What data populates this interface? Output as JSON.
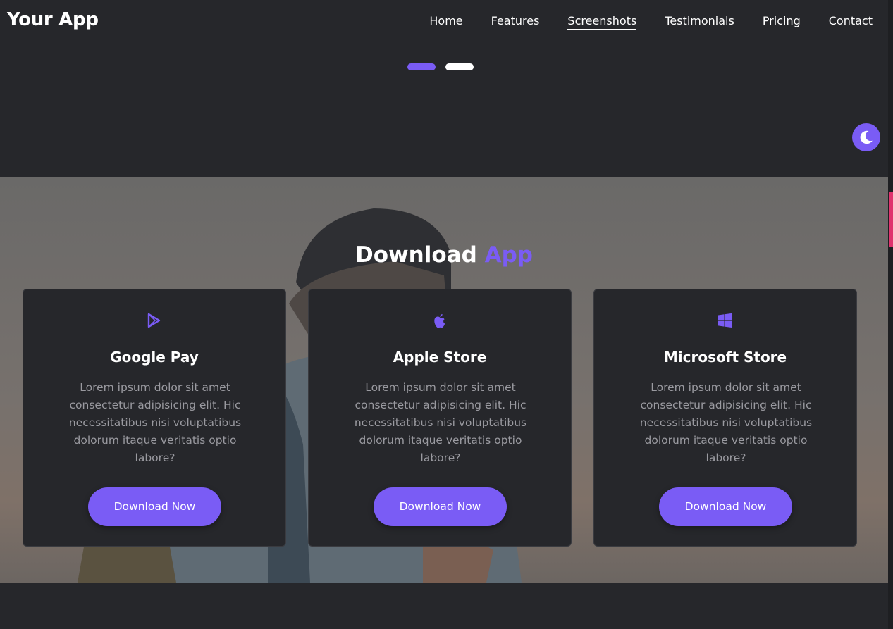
{
  "nav": {
    "brand": "Your App",
    "links": [
      {
        "label": "Home",
        "active": false
      },
      {
        "label": "Features",
        "active": false
      },
      {
        "label": "Screenshots",
        "active": true
      },
      {
        "label": "Testimonials",
        "active": false
      },
      {
        "label": "Pricing",
        "active": false
      },
      {
        "label": "Contact",
        "active": false
      }
    ]
  },
  "slider": {
    "dots": [
      {
        "state": "active"
      },
      {
        "state": "inactive"
      }
    ]
  },
  "theme_toggle": {
    "icon": "moon-icon"
  },
  "download": {
    "title_main": "Download",
    "title_accent": "App",
    "cards": [
      {
        "icon": "google-play-icon",
        "title": "Google Pay",
        "body": "Lorem ipsum dolor sit amet consectetur adipisicing elit. Hic necessitatibus nisi voluptatibus dolorum itaque veritatis optio labore?",
        "button": "Download Now"
      },
      {
        "icon": "apple-icon",
        "title": "Apple Store",
        "body": "Lorem ipsum dolor sit amet consectetur adipisicing elit. Hic necessitatibus nisi voluptatibus dolorum itaque veritatis optio labore?",
        "button": "Download Now"
      },
      {
        "icon": "windows-icon",
        "title": "Microsoft Store",
        "body": "Lorem ipsum dolor sit amet consectetur adipisicing elit. Hic necessitatibus nisi voluptatibus dolorum itaque veritatis optio labore?",
        "button": "Download Now"
      }
    ]
  },
  "colors": {
    "accent": "#7a5cf5",
    "background": "#26272b",
    "side_accent": "#e0336e"
  }
}
